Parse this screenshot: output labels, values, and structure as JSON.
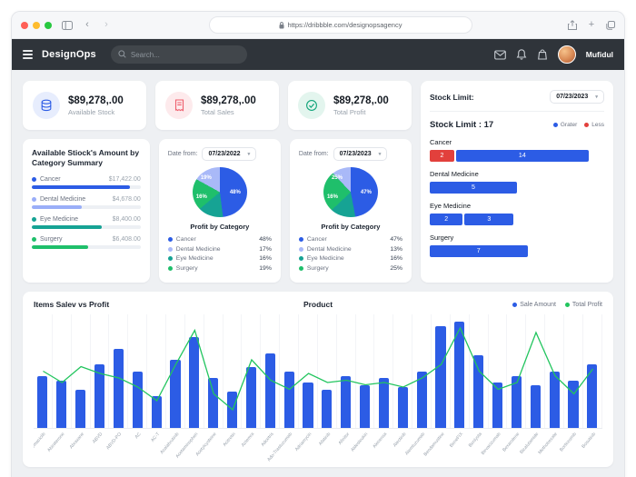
{
  "browser": {
    "url": "https://dribbble.com/designopsagency"
  },
  "icons": {
    "back": "‹",
    "forward": "›",
    "plus": "+",
    "chevron_down": "▾",
    "menu": "hamburger",
    "search": "magnifier",
    "mail": "envelope",
    "bell": "notification-bell",
    "bag": "shopping-bag",
    "lock": "padlock"
  },
  "navbar": {
    "brand": "DesignOps",
    "search_placeholder": "Search...",
    "username": "Mufidul"
  },
  "stats": [
    {
      "value": "$89,278,.00",
      "label": "Available Stock",
      "accent": "#2c5ce5",
      "icon_bg": "#e7edfd"
    },
    {
      "value": "$89,278,.00",
      "label": "Total Sales",
      "accent": "#ee5d6c",
      "icon_bg": "#fdeaec"
    },
    {
      "value": "$89,278,.00",
      "label": "Total Profit",
      "accent": "#12a57a",
      "icon_bg": "#e3f5ee"
    }
  ],
  "category_summary": {
    "title": "Available Stiock's Amount by Category Summary",
    "items": [
      {
        "label": "Cancer",
        "value": "$17,422.00",
        "color": "#2c5ce5",
        "pct": 90
      },
      {
        "label": "Dental Medicine",
        "value": "$4,678.00",
        "color": "#9aaef8",
        "pct": 46
      },
      {
        "label": "Eye Medicine",
        "value": "$8,400.00",
        "color": "#16a394",
        "pct": 64
      },
      {
        "label": "Surgery",
        "value": "$6,408.00",
        "color": "#1fbf6b",
        "pct": 52
      }
    ]
  },
  "pie_cards": [
    {
      "date_label": "Date from:",
      "date_value": "07/23/2022",
      "title": "Profit by Category",
      "slices": [
        {
          "label": "Cancer",
          "pct": 48,
          "pct_label": "48%",
          "color": "#2c5ce5"
        },
        {
          "label": "Dental Medicine",
          "pct": 17,
          "pct_label": "17%",
          "color": "#a9b9f8"
        },
        {
          "label": "Eye Medicine",
          "pct": 16,
          "pct_label": "16%",
          "color": "#16a394"
        },
        {
          "label": "Surgery",
          "pct": 19,
          "pct_label": "19%",
          "color": "#1fbf6b"
        }
      ]
    },
    {
      "date_label": "Date from:",
      "date_value": "07/23/2023",
      "title": "Profit by Category",
      "slices": [
        {
          "label": "Cancer",
          "pct": 47,
          "pct_label": "47%",
          "color": "#2c5ce5"
        },
        {
          "label": "Dental Medicine",
          "pct": 13,
          "pct_label": "13%",
          "color": "#a9b9f8"
        },
        {
          "label": "Eye Medicine",
          "pct": 16,
          "pct_label": "16%",
          "color": "#16a394"
        },
        {
          "label": "Surgery",
          "pct": 25,
          "pct_label": "25%",
          "color": "#1fbf6b"
        }
      ]
    }
  ],
  "stock_limit": {
    "header_label": "Stock Limit:",
    "date_value": "07/23/2023",
    "title": "Stock Limit : 17",
    "legend": [
      {
        "label": "Grater",
        "color": "#2c5ce5"
      },
      {
        "label": "Less",
        "color": "#e2403c"
      }
    ],
    "rows": [
      {
        "label": "Cancer",
        "bars": [
          {
            "value": "2",
            "color": "#e2403c",
            "width_pct": 14
          },
          {
            "value": "14",
            "color": "#2c5ce5",
            "width_pct": 76
          }
        ]
      },
      {
        "label": "Dental Medicine",
        "bars": [
          {
            "value": "5",
            "color": "#2c5ce5",
            "width_pct": 50
          }
        ]
      },
      {
        "label": "Eye Medicine",
        "bars": [
          {
            "value": "2",
            "color": "#2c5ce5",
            "width_pct": 19
          },
          {
            "value": "3",
            "color": "#2c5ce5",
            "width_pct": 28
          }
        ]
      },
      {
        "label": "Surgery",
        "bars": [
          {
            "value": "7",
            "color": "#2c5ce5",
            "width_pct": 56
          }
        ]
      }
    ]
  },
  "main_chart": {
    "title": "Items Salev vs Profit",
    "subtitle": "Product",
    "legend": [
      {
        "label": "Sale Amount",
        "color": "#2c5ce5"
      },
      {
        "label": "Total Profit",
        "color": "#22c55e"
      }
    ],
    "chart_data": {
      "type": "bar",
      "note": "blue bars = Sale Amount with green Total Profit line overlay, values estimated 0-100 scale",
      "categories": [
        "Abemaciclib",
        "Abiraterone",
        "Abraxane",
        "ABVD",
        "ABVD-PO",
        "AC",
        "AC-T",
        "Acalabrutinib",
        "Acetaminophen",
        "Acetylcysteine",
        "Acitretin",
        "Actemra",
        "Adcetris",
        "Ado-Trastuzumab",
        "Adriamycin",
        "Afatinib",
        "Afinitor",
        "Aldesleukin",
        "Alecensa",
        "Alectinib",
        "Alemtuzumab",
        "Bendamustine",
        "BeneFIX",
        "Benlysta",
        "Bevacizumab",
        "Bexarotene",
        "Bicalutamide",
        "Methotrexate",
        "Bortezomib",
        "Bosutinib"
      ],
      "series": [
        {
          "name": "Sale Amount",
          "values": [
            46,
            42,
            34,
            56,
            70,
            50,
            28,
            60,
            80,
            44,
            32,
            54,
            66,
            50,
            40,
            34,
            46,
            38,
            44,
            36,
            50,
            90,
            94,
            64,
            40,
            46,
            38,
            50,
            42,
            56
          ]
        },
        {
          "name": "Total Profit",
          "values": [
            50,
            40,
            54,
            48,
            44,
            36,
            24,
            56,
            86,
            30,
            16,
            60,
            42,
            34,
            48,
            40,
            42,
            38,
            40,
            36,
            44,
            56,
            88,
            50,
            34,
            40,
            84,
            46,
            30,
            52
          ]
        }
      ],
      "ylim": [
        0,
        100
      ],
      "grid": "vertical",
      "legend_position": "top-right"
    }
  }
}
